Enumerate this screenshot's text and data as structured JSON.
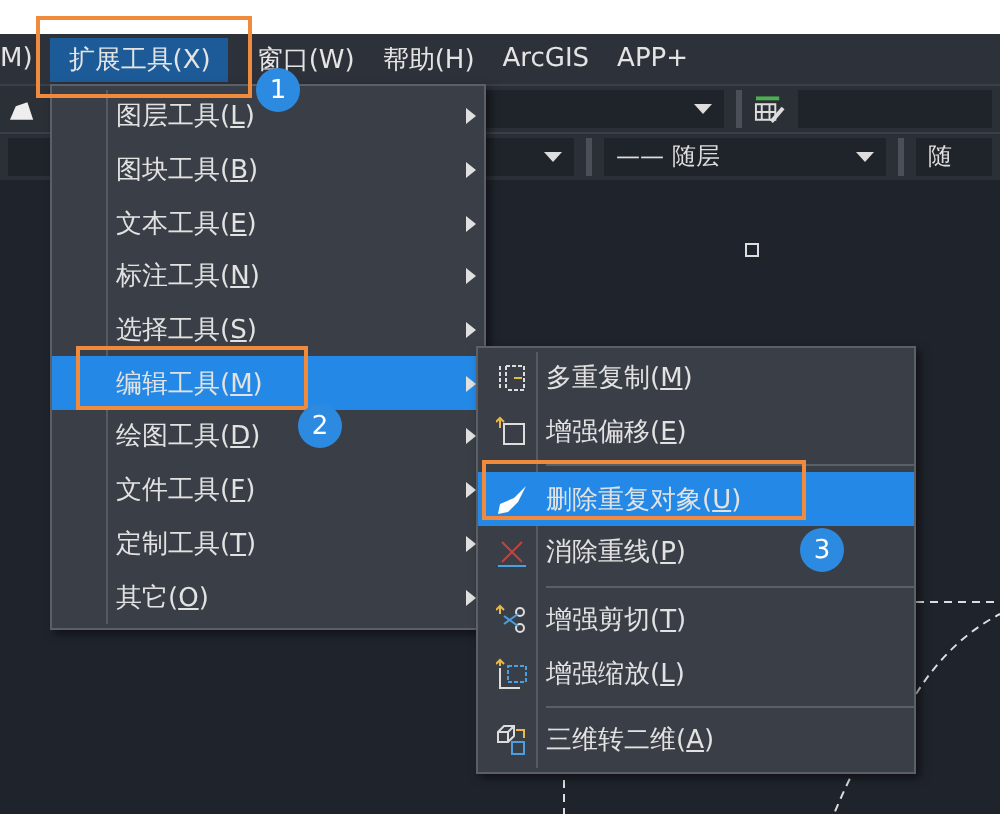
{
  "menubar": {
    "items": [
      {
        "label": "M)",
        "selected": false
      },
      {
        "label": "扩展工具(X)",
        "selected": true
      },
      {
        "label": "窗口(W)",
        "selected": false
      },
      {
        "label": "帮助(H)",
        "selected": false
      },
      {
        "label": "ArcGIS",
        "selected": false
      },
      {
        "label": "APP+",
        "selected": false
      }
    ]
  },
  "toolbar": {
    "linetype": "—— 随层",
    "field_cut": "随"
  },
  "menu": {
    "items": [
      {
        "label": "图层工具(L)",
        "selected": false,
        "has_submenu": true
      },
      {
        "label": "图块工具(B)",
        "selected": false,
        "has_submenu": true
      },
      {
        "label": "文本工具(E)",
        "selected": false,
        "has_submenu": true
      },
      {
        "label": "标注工具(N)",
        "selected": false,
        "has_submenu": true
      },
      {
        "label": "选择工具(S)",
        "selected": false,
        "has_submenu": true
      },
      {
        "label": "编辑工具(M)",
        "selected": true,
        "has_submenu": true
      },
      {
        "label": "绘图工具(D)",
        "selected": false,
        "has_submenu": true
      },
      {
        "label": "文件工具(F)",
        "selected": false,
        "has_submenu": true
      },
      {
        "label": "定制工具(T)",
        "selected": false,
        "has_submenu": true
      },
      {
        "label": "其它(O)",
        "selected": false,
        "has_submenu": true
      }
    ]
  },
  "submenu": {
    "items": [
      {
        "kind": "item",
        "label": "多重复制(M)",
        "selected": false
      },
      {
        "kind": "item",
        "label": "增强偏移(E)",
        "selected": false
      },
      {
        "kind": "separator"
      },
      {
        "kind": "item",
        "label": "删除重复对象(U)",
        "selected": true
      },
      {
        "kind": "item",
        "label": "消除重线(P)",
        "selected": false
      },
      {
        "kind": "separator"
      },
      {
        "kind": "item",
        "label": "增强剪切(T)",
        "selected": false
      },
      {
        "kind": "item",
        "label": "增强缩放(L)",
        "selected": false
      },
      {
        "kind": "separator"
      },
      {
        "kind": "item",
        "label": "三维转二维(A)",
        "selected": false
      }
    ]
  },
  "callouts": [
    {
      "number": "1"
    },
    {
      "number": "2"
    },
    {
      "number": "3"
    }
  ]
}
